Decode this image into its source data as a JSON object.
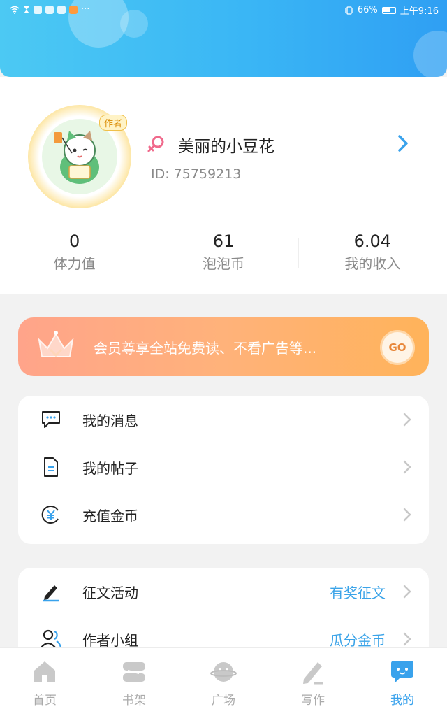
{
  "status_bar": {
    "battery": "66%",
    "time": "上午9:16",
    "more": "···"
  },
  "profile": {
    "avatar_tag": "作者",
    "username": "美丽的小豆花",
    "id_label": "ID:",
    "id_value": "75759213"
  },
  "stats": [
    {
      "value": "0",
      "label": "体力值"
    },
    {
      "value": "61",
      "label": "泡泡币"
    },
    {
      "value": "6.04",
      "label": "我的收入"
    }
  ],
  "vip": {
    "text": "会员尊享全站免费读、不看广告等...",
    "go_label": "GO"
  },
  "menu1": [
    {
      "label": "我的消息"
    },
    {
      "label": "我的帖子"
    },
    {
      "label": "充值金币"
    }
  ],
  "menu2": [
    {
      "label": "征文活动",
      "value": "有奖征文"
    },
    {
      "label": "作者小组",
      "value": "瓜分金币"
    }
  ],
  "tabs": [
    {
      "label": "首页",
      "icon": "home-icon"
    },
    {
      "label": "书架",
      "icon": "bookshelf-icon"
    },
    {
      "label": "广场",
      "icon": "planet-icon"
    },
    {
      "label": "写作",
      "icon": "pen-icon"
    },
    {
      "label": "我的",
      "icon": "chat-bubble-icon",
      "active": true
    }
  ],
  "colors": {
    "accent": "#39a2ec",
    "header": "#3ab6f5",
    "vip_start": "#ffa48a",
    "vip_end": "#ffb35a",
    "gender": "#f06a8c"
  }
}
